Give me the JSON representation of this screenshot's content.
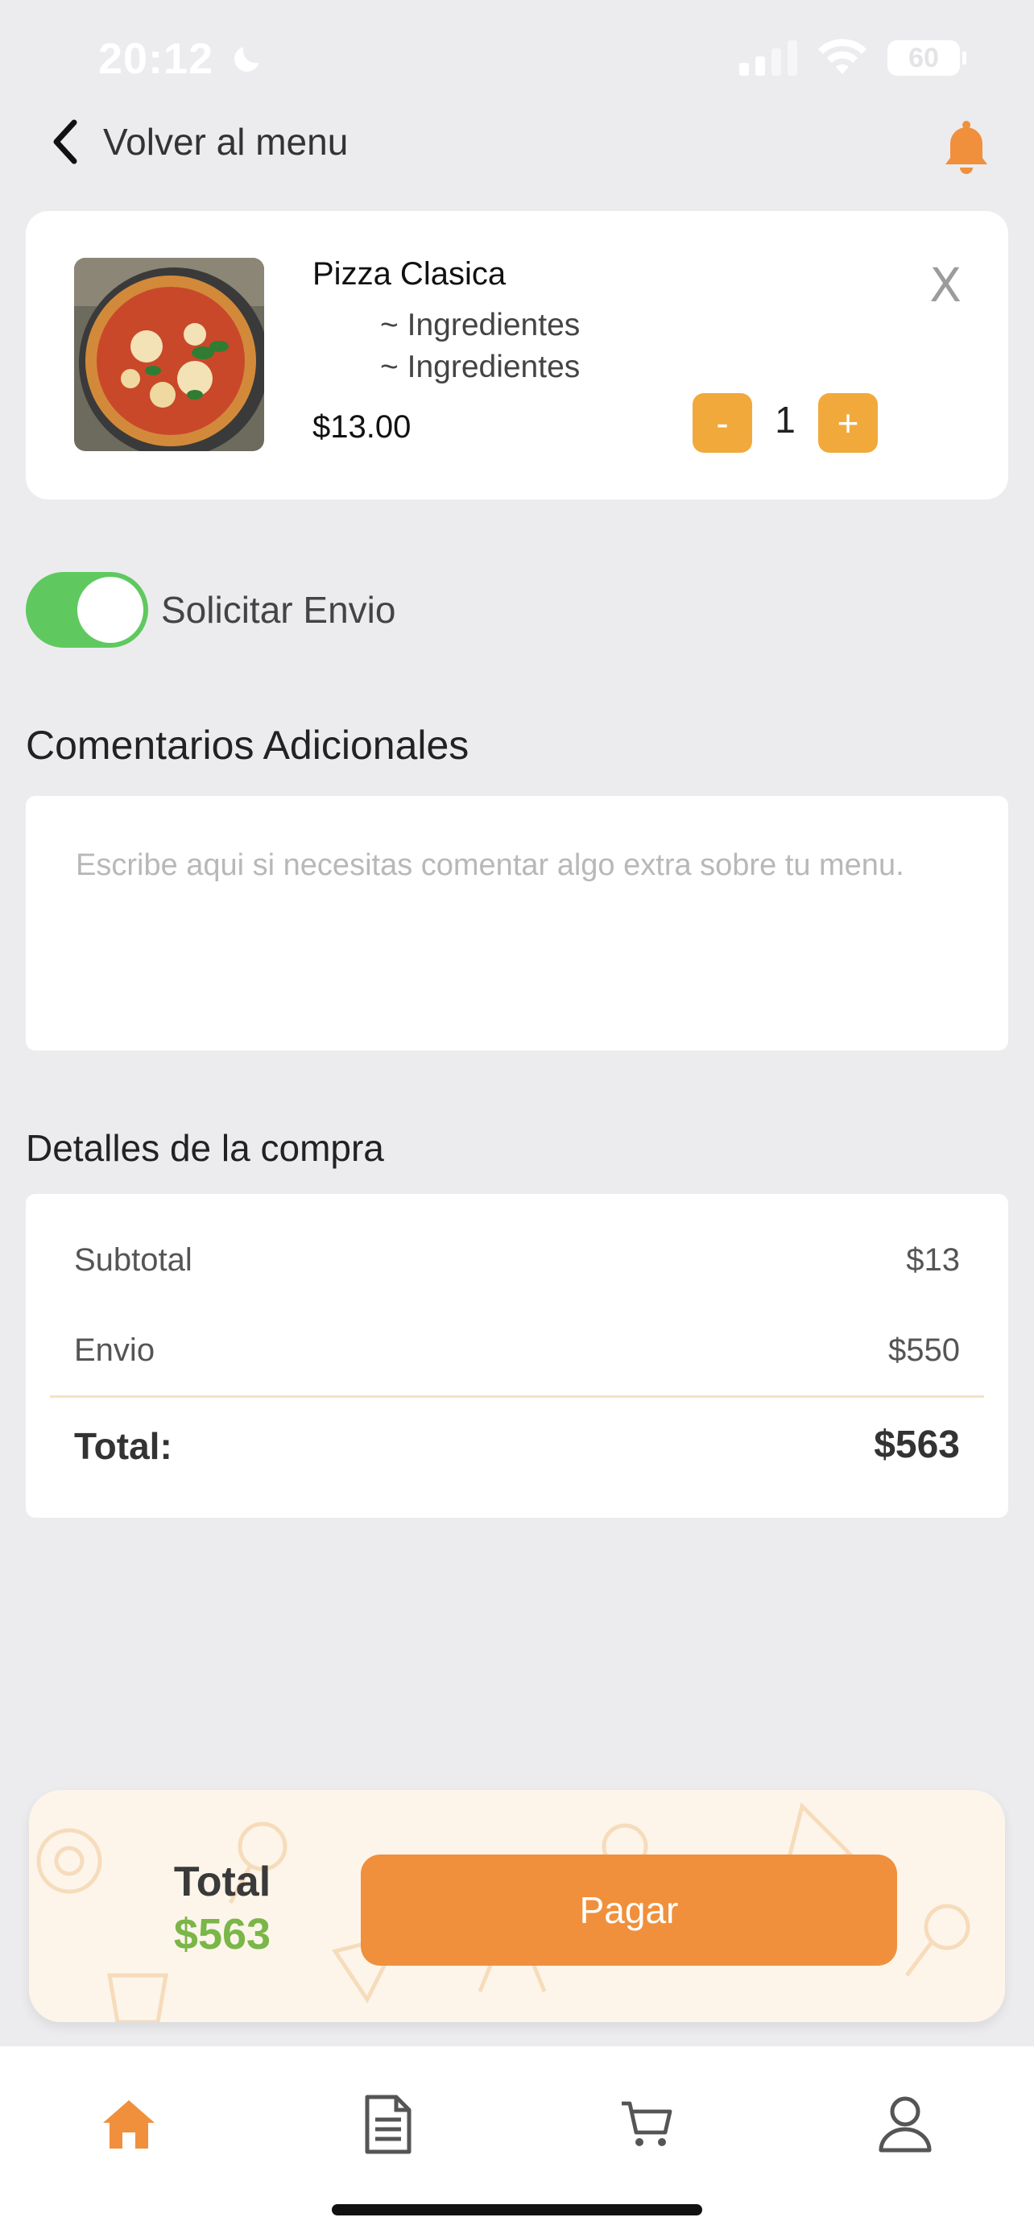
{
  "status_bar": {
    "time": "20:12",
    "battery": "60"
  },
  "header": {
    "back_label": "Volver al menu"
  },
  "cart_item": {
    "name": "Pizza Clasica",
    "ingredients": [
      "~ Ingredientes",
      "~ Ingredientes"
    ],
    "price": "$13.00",
    "quantity": "1",
    "minus_label": "-",
    "plus_label": "+",
    "remove_label": "X"
  },
  "delivery": {
    "label": "Solicitar Envio",
    "enabled": true
  },
  "comments": {
    "title": "Comentarios Adicionales",
    "placeholder": "Escribe aqui si necesitas comentar algo extra sobre tu menu."
  },
  "details": {
    "title": "Detalles de la compra",
    "subtotal_label": "Subtotal",
    "subtotal_value": "$13",
    "shipping_label": "Envio",
    "shipping_value": "$550",
    "total_label": "Total:",
    "total_value": "$563"
  },
  "pay_bar": {
    "total_label": "Total",
    "total_value": "$563",
    "pay_label": "Pagar"
  },
  "colors": {
    "accent": "#f0903c",
    "button": "#f2a93b",
    "toggle_on": "#5fc95f",
    "total_green": "#7ab648"
  },
  "nav": [
    "home-icon",
    "document-icon",
    "cart-icon",
    "user-icon"
  ]
}
